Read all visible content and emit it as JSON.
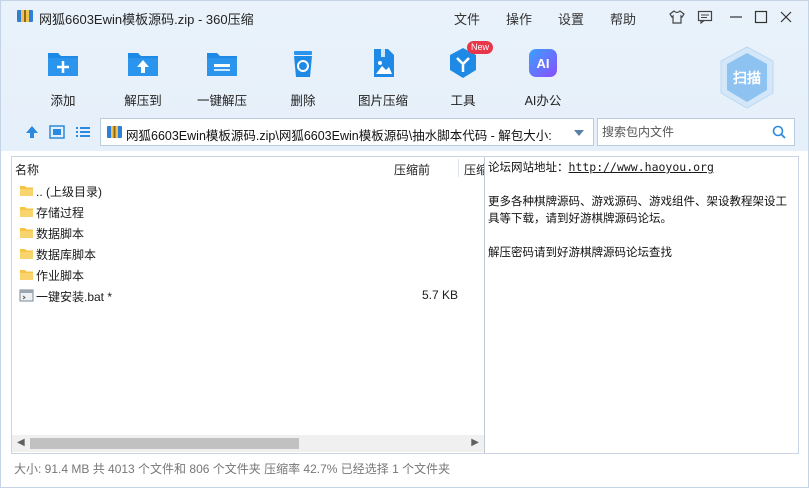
{
  "window": {
    "title": "网狐6603Ewin模板源码.zip - 360压缩"
  },
  "menu": [
    "文件",
    "操作",
    "设置",
    "帮助"
  ],
  "toolbar": [
    {
      "label": "添加",
      "icon": "add-icon"
    },
    {
      "label": "解压到",
      "icon": "extract-to-icon"
    },
    {
      "label": "一键解压",
      "icon": "one-click-extract-icon"
    },
    {
      "label": "删除",
      "icon": "delete-icon"
    },
    {
      "label": "图片压缩",
      "icon": "image-compress-icon"
    },
    {
      "label": "工具",
      "icon": "tools-icon",
      "badge": "New"
    },
    {
      "label": "AI办公",
      "icon": "ai-office-icon",
      "icon_text": "AI"
    }
  ],
  "scan": {
    "label": "扫描"
  },
  "address": {
    "path": "网狐6603Ewin模板源码.zip\\网狐6603Ewin模板源码\\抽水脚本代码 - 解包大小:"
  },
  "search": {
    "placeholder": "搜索包内文件"
  },
  "columns": {
    "name": "名称",
    "before": "压缩前",
    "after": "压缩"
  },
  "files": [
    {
      "name": ".. (上级目录)",
      "type": "folder",
      "size": ""
    },
    {
      "name": "存储过程",
      "type": "folder",
      "size": ""
    },
    {
      "name": "数据脚本",
      "type": "folder",
      "size": ""
    },
    {
      "name": "数据库脚本",
      "type": "folder",
      "size": ""
    },
    {
      "name": "作业脚本",
      "type": "folder",
      "size": ""
    },
    {
      "name": "一键安装.bat *",
      "type": "bat",
      "size": "5.7 KB"
    }
  ],
  "comment": {
    "line1_prefix": "论坛网站地址：",
    "line1_link": "http://www.haoyou.org",
    "line2": "更多各种棋牌源码、游戏源码、游戏组件、架设教程架设工具等下载，请到好游棋牌源码论坛。",
    "line3": "解压密码请到好游棋牌源码论坛查找"
  },
  "status": "大小: 91.4 MB 共 4013 个文件和 806 个文件夹 压缩率 42.7% 已经选择 1 个文件夹",
  "colors": {
    "accent": "#1e8ae6",
    "background": "#e9f2fb",
    "folder": "#f6c343"
  }
}
